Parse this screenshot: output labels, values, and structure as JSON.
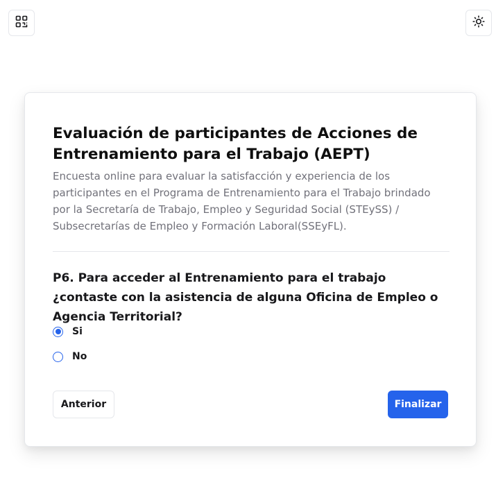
{
  "toolbar": {
    "qr_icon": "qr-code-icon",
    "theme_icon": "sun-icon"
  },
  "survey": {
    "title": "Evaluación de participantes de Acciones de Entrenamiento para el Trabajo (AEPT)",
    "description": "Encuesta online para evaluar la satisfacción y experiencia de los participantes en el Programa de Entrenamiento para el Trabajo brindado por la Secretaría de Trabajo, Empleo y Seguridad Social (STEySS) / Subsecretarías de Empleo y Formación Laboral(SSEyFL)."
  },
  "question": {
    "text": "P6. Para acceder al Entrenamiento para el trabajo ¿contaste con la asistencia de alguna Oficina de Empleo o Agencia Territorial?",
    "options": [
      {
        "label": "Si",
        "selected": true
      },
      {
        "label": "No",
        "selected": false
      }
    ]
  },
  "navigation": {
    "previous_label": "Anterior",
    "finish_label": "Finalizar"
  },
  "colors": {
    "accent": "#2563eb",
    "text_primary": "#18181b",
    "text_muted": "#71717a",
    "border": "#e5e7eb"
  }
}
